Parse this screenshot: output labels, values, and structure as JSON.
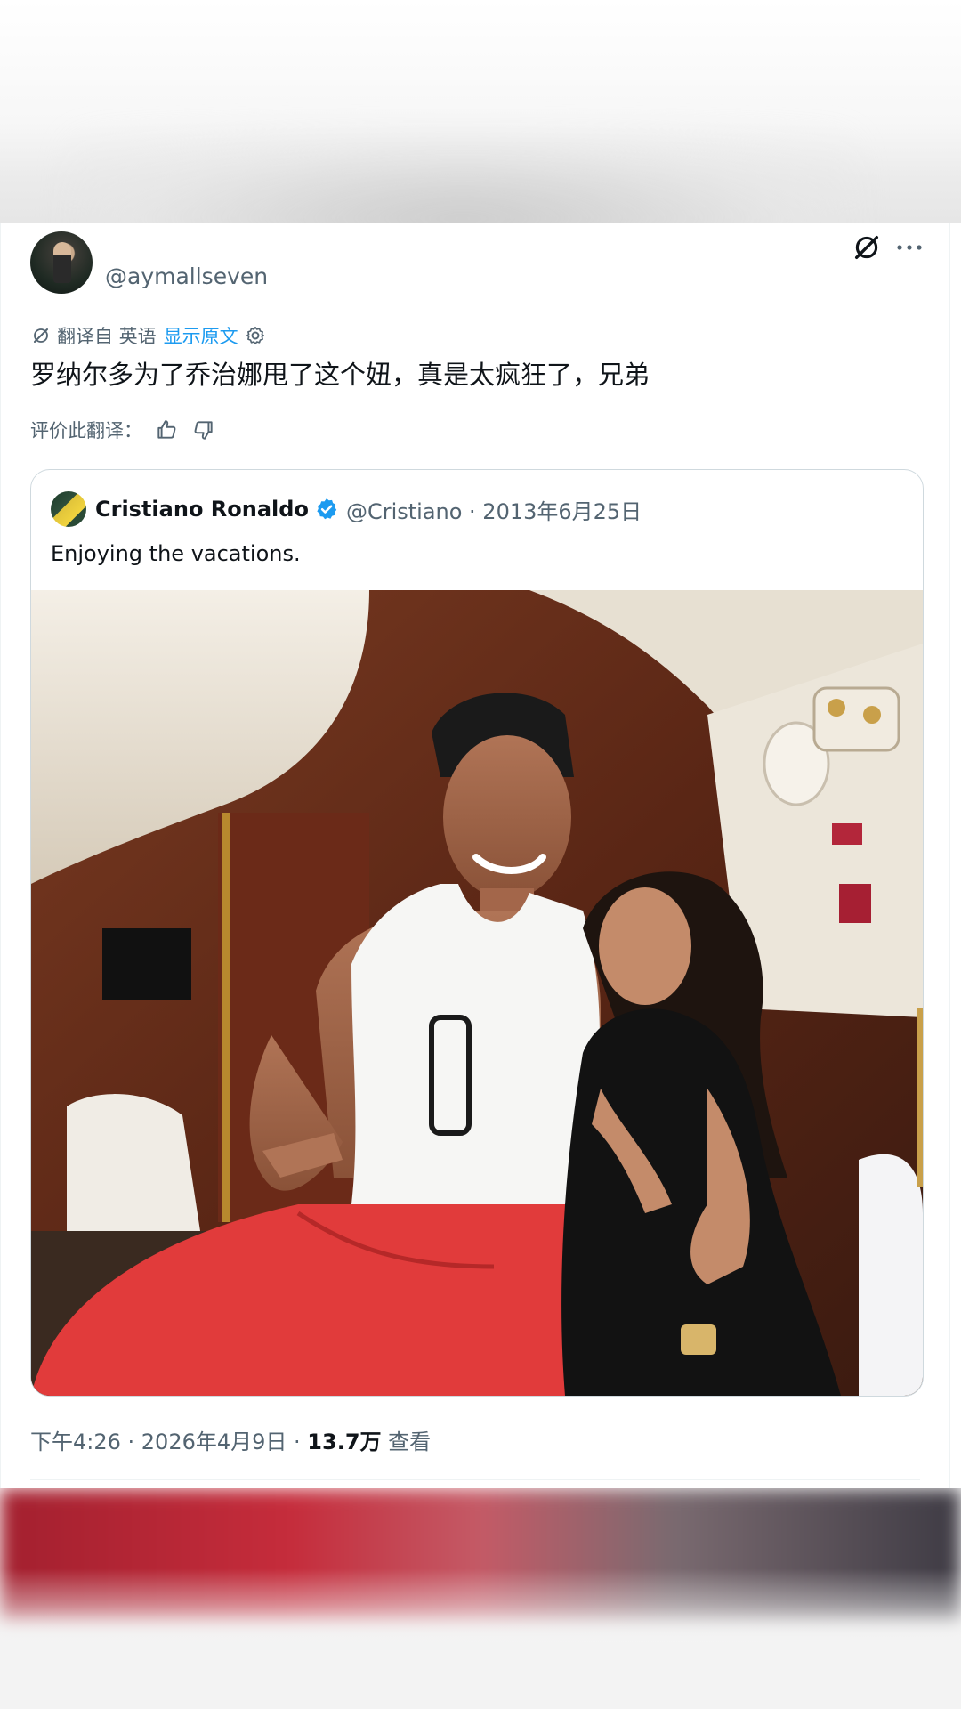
{
  "post": {
    "handle": "@aymallseven",
    "translation_bar": {
      "prefix": "翻译自 英语",
      "show_original": "显示原文"
    },
    "text": "罗纳尔多为了乔治娜甩了这个妞，真是太疯狂了，兄弟",
    "rate_translation": "评价此翻译：",
    "timestamp": "下午4:26 · 2026年4月9日 · ",
    "views_count": "13.7万",
    "views_label": " 查看"
  },
  "quoted": {
    "name": "Cristiano Ronaldo",
    "meta": "@Cristiano · 2013年6月25日",
    "text": "Enjoying the vacations."
  },
  "icons": {
    "grok": "grok-icon",
    "more": "more-icon",
    "translate": "translate-icon",
    "settings": "gear-icon",
    "thumbs_up": "thumbs-up-icon",
    "thumbs_down": "thumbs-down-icon",
    "verified": "verified-badge-icon"
  },
  "colors": {
    "link": "#1d9bf0",
    "secondary_text": "#536471",
    "primary_text": "#0f1419",
    "border": "#cfd9de"
  }
}
